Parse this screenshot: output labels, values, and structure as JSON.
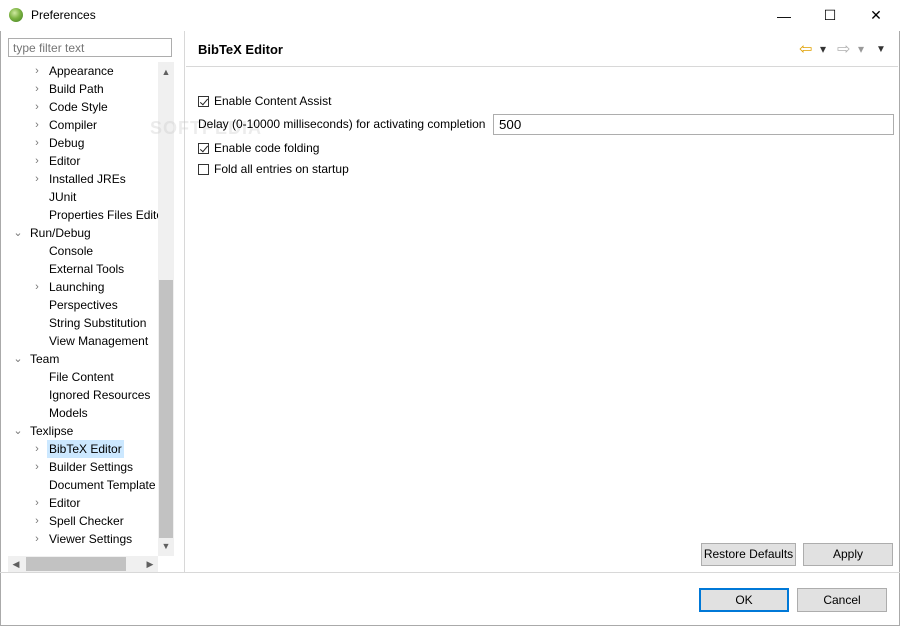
{
  "window": {
    "title": "Preferences",
    "minimize": "—",
    "maximize": "☐",
    "close": "✕"
  },
  "filter": {
    "placeholder": "type filter text"
  },
  "tree": [
    {
      "label": "Appearance",
      "arrow": "›",
      "indent": 2
    },
    {
      "label": "Build Path",
      "arrow": "›",
      "indent": 2
    },
    {
      "label": "Code Style",
      "arrow": "›",
      "indent": 2
    },
    {
      "label": "Compiler",
      "arrow": "›",
      "indent": 2
    },
    {
      "label": "Debug",
      "arrow": "›",
      "indent": 2
    },
    {
      "label": "Editor",
      "arrow": "›",
      "indent": 2
    },
    {
      "label": "Installed JREs",
      "arrow": "›",
      "indent": 2
    },
    {
      "label": "JUnit",
      "arrow": "",
      "indent": 2
    },
    {
      "label": "Properties Files Editor",
      "arrow": "",
      "indent": 2
    },
    {
      "label": "Run/Debug",
      "arrow": "⌄",
      "indent": 1
    },
    {
      "label": "Console",
      "arrow": "",
      "indent": 2
    },
    {
      "label": "External Tools",
      "arrow": "",
      "indent": 2
    },
    {
      "label": "Launching",
      "arrow": "›",
      "indent": 2
    },
    {
      "label": "Perspectives",
      "arrow": "",
      "indent": 2
    },
    {
      "label": "String Substitution",
      "arrow": "",
      "indent": 2
    },
    {
      "label": "View Management",
      "arrow": "",
      "indent": 2
    },
    {
      "label": "Team",
      "arrow": "⌄",
      "indent": 1
    },
    {
      "label": "File Content",
      "arrow": "",
      "indent": 2
    },
    {
      "label": "Ignored Resources",
      "arrow": "",
      "indent": 2
    },
    {
      "label": "Models",
      "arrow": "",
      "indent": 2
    },
    {
      "label": "Texlipse",
      "arrow": "⌄",
      "indent": 1
    },
    {
      "label": "BibTeX Editor",
      "arrow": "›",
      "indent": 2,
      "selected": true
    },
    {
      "label": "Builder Settings",
      "arrow": "›",
      "indent": 2
    },
    {
      "label": "Document Template",
      "arrow": "",
      "indent": 2
    },
    {
      "label": "Editor",
      "arrow": "›",
      "indent": 2
    },
    {
      "label": "Spell Checker",
      "arrow": "›",
      "indent": 2
    },
    {
      "label": "Viewer Settings",
      "arrow": "›",
      "indent": 2
    }
  ],
  "page": {
    "title": "BibTeX Editor",
    "back_icon": "⇦",
    "forward_icon": "⇨",
    "dropdown": "▾",
    "menu": "▼"
  },
  "settings": {
    "content_assist": {
      "label": "Enable Content Assist",
      "checked": true
    },
    "delay_label": "Delay (0-10000 milliseconds) for activating completion",
    "delay_value": "500",
    "code_folding": {
      "label": "Enable code folding",
      "checked": true
    },
    "fold_all": {
      "label": "Fold all entries on startup",
      "checked": false
    }
  },
  "buttons": {
    "restore_defaults": "Restore Defaults",
    "apply": "Apply",
    "ok": "OK",
    "cancel": "Cancel"
  },
  "scroll": {
    "up": "▲",
    "down": "▼",
    "left": "◀",
    "right": "▶"
  }
}
